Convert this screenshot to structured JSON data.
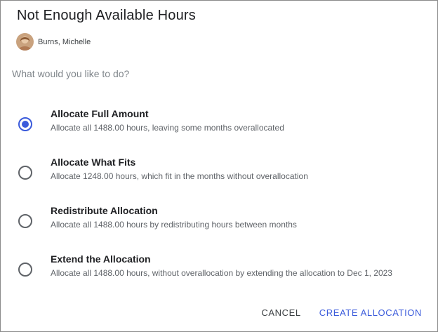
{
  "dialog": {
    "title": "Not Enough Available Hours",
    "person_name": "Burns, Michelle",
    "question": "What would you like to do?"
  },
  "options": [
    {
      "title": "Allocate Full Amount",
      "description": "Allocate all 1488.00 hours, leaving some months overallocated",
      "selected": true
    },
    {
      "title": "Allocate What Fits",
      "description": "Allocate 1248.00 hours, which fit in the months without overallocation",
      "selected": false
    },
    {
      "title": "Redistribute Allocation",
      "description": "Allocate all 1488.00 hours by redistributing hours between months",
      "selected": false
    },
    {
      "title": "Extend the Allocation",
      "description": "Allocate all 1488.00 hours, without overallocation by extending the allocation to Dec 1, 2023",
      "selected": false
    }
  ],
  "actions": {
    "cancel_label": "CANCEL",
    "create_label": "CREATE ALLOCATION"
  },
  "colors": {
    "accent": "#3b5bdb",
    "title_text": "#202124",
    "muted_text": "#80868b"
  }
}
